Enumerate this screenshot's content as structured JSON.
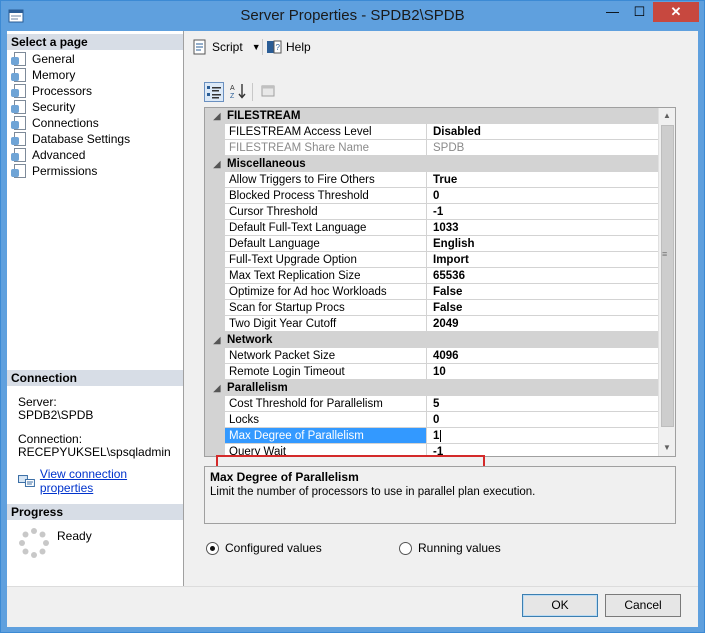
{
  "window": {
    "title": "Server Properties - SPDB2\\SPDB",
    "minimize": "—",
    "maximize": "☐",
    "close": "✕"
  },
  "left_pane": {
    "select_page_header": "Select a page",
    "pages": [
      {
        "label": "General",
        "icon": "wrench-page-icon"
      },
      {
        "label": "Memory",
        "icon": "wrench-page-icon"
      },
      {
        "label": "Processors",
        "icon": "wrench-page-icon"
      },
      {
        "label": "Security",
        "icon": "wrench-page-icon"
      },
      {
        "label": "Connections",
        "icon": "wrench-page-icon"
      },
      {
        "label": "Database Settings",
        "icon": "wrench-page-icon"
      },
      {
        "label": "Advanced",
        "icon": "wrench-page-icon"
      },
      {
        "label": "Permissions",
        "icon": "wrench-page-icon"
      }
    ],
    "connection_header": "Connection",
    "server_label": "Server:",
    "server_value": "SPDB2\\SPDB",
    "connection_label": "Connection:",
    "connection_value": "RECEPYUKSEL\\spsqladmin",
    "view_connection_link": "View connection properties",
    "progress_header": "Progress",
    "progress_status": "Ready"
  },
  "toolbar": {
    "script_label": "Script",
    "help_label": "Help"
  },
  "property_grid": {
    "categories": [
      {
        "name": "FILESTREAM",
        "properties": [
          {
            "name": "FILESTREAM Access Level",
            "value": "Disabled",
            "readonly": false
          },
          {
            "name": "FILESTREAM Share Name",
            "value": "SPDB",
            "readonly": true
          }
        ]
      },
      {
        "name": "Miscellaneous",
        "properties": [
          {
            "name": "Allow Triggers to Fire Others",
            "value": "True"
          },
          {
            "name": "Blocked Process Threshold",
            "value": "0"
          },
          {
            "name": "Cursor Threshold",
            "value": "-1"
          },
          {
            "name": "Default Full-Text Language",
            "value": "1033"
          },
          {
            "name": "Default Language",
            "value": "English"
          },
          {
            "name": "Full-Text Upgrade Option",
            "value": "Import"
          },
          {
            "name": "Max Text Replication Size",
            "value": "65536"
          },
          {
            "name": "Optimize for Ad hoc Workloads",
            "value": "False"
          },
          {
            "name": "Scan for Startup Procs",
            "value": "False"
          },
          {
            "name": "Two Digit Year Cutoff",
            "value": "2049"
          }
        ]
      },
      {
        "name": "Network",
        "properties": [
          {
            "name": "Network Packet Size",
            "value": "4096"
          },
          {
            "name": "Remote Login Timeout",
            "value": "10"
          }
        ]
      },
      {
        "name": "Parallelism",
        "properties": [
          {
            "name": "Cost Threshold for Parallelism",
            "value": "5"
          },
          {
            "name": "Locks",
            "value": "0"
          },
          {
            "name": "Max Degree of Parallelism",
            "value": "1",
            "selected": true
          },
          {
            "name": "Query Wait",
            "value": "-1"
          }
        ]
      }
    ]
  },
  "description": {
    "title": "Max Degree of Parallelism",
    "text": "Limit the number of processors to use in parallel plan execution."
  },
  "options": {
    "configured_values": "Configured values",
    "running_values": "Running values",
    "selected": "configured_values"
  },
  "footer": {
    "ok_label": "OK",
    "cancel_label": "Cancel"
  },
  "colors": {
    "title_bar": "#5fa0de",
    "close_button": "#c7483f",
    "section_header": "#d7dde6",
    "selection": "#3399ff",
    "highlight_box": "#d42a2a",
    "link": "#0033cc"
  }
}
